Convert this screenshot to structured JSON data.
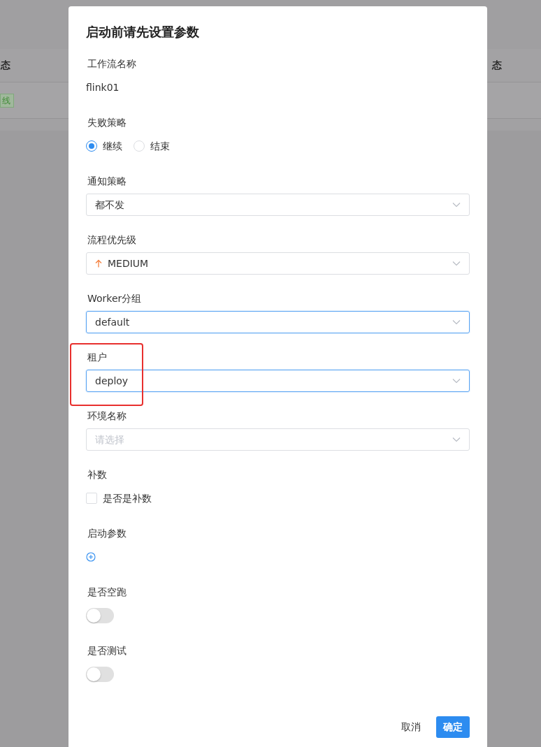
{
  "background": {
    "table_headers": [
      "态",
      "态"
    ],
    "status_tag": "线"
  },
  "dialog": {
    "title": "启动前请先设置参数",
    "fields": [
      {
        "kind": "text",
        "label": "工作流名称",
        "value": "flink01"
      },
      {
        "kind": "radio",
        "label": "失败策略",
        "options": [
          {
            "label": "继续",
            "selected": true
          },
          {
            "label": "结束",
            "selected": false
          }
        ]
      },
      {
        "kind": "select",
        "label": "通知策略",
        "value": "都不发",
        "focused": false
      },
      {
        "kind": "priority",
        "label": "流程优先级",
        "value": "MEDIUM",
        "focused": false
      },
      {
        "kind": "select",
        "label": "Worker分组",
        "value": "default",
        "focused": true
      },
      {
        "kind": "select",
        "label": "租户",
        "value": "deploy",
        "focused": true,
        "highlighted": true
      },
      {
        "kind": "select",
        "label": "环境名称",
        "placeholder": "请选择",
        "focused": false
      },
      {
        "kind": "checkbox",
        "label": "补数",
        "option": "是否是补数",
        "checked": false
      },
      {
        "kind": "add",
        "label": "启动参数"
      },
      {
        "kind": "switch",
        "label": "是否空跑",
        "on": false
      },
      {
        "kind": "switch",
        "label": "是否测试",
        "on": false
      }
    ],
    "buttons": [
      {
        "label": "取消",
        "kind": "secondary"
      },
      {
        "label": "确定",
        "kind": "primary"
      }
    ]
  }
}
